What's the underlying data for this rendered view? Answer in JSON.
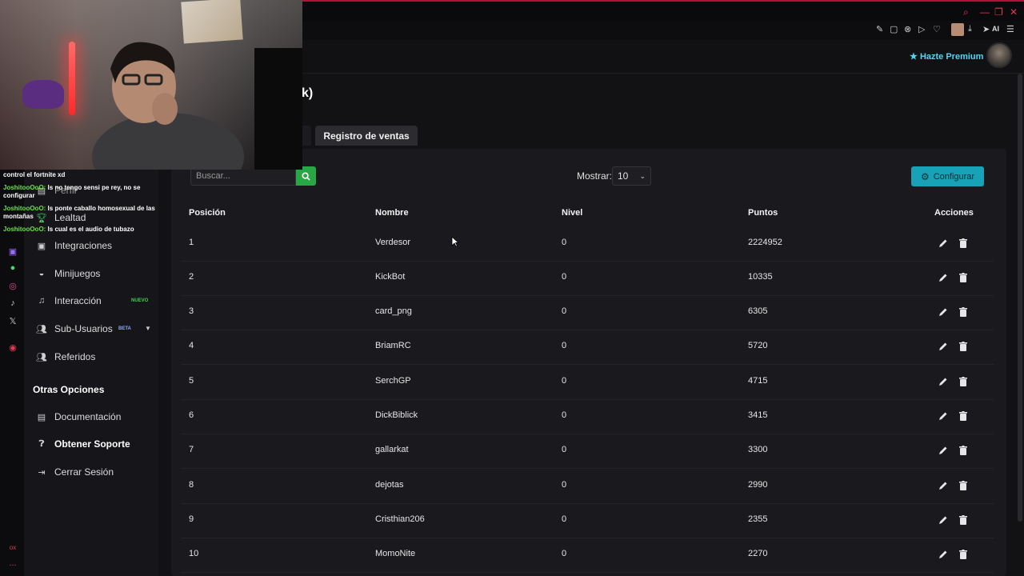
{
  "browser": {
    "ai_label": "AI",
    "accent": "#e03a55"
  },
  "header": {
    "premium_label": "Hazte Premium",
    "premium_color": "#55d4f0"
  },
  "page": {
    "title_fragment": "k)",
    "tab_active": "Registro de ventas"
  },
  "toolbar": {
    "search_placeholder": "Buscar...",
    "show_label": "Mostrar:",
    "show_value": "10",
    "config_label": "Configurar",
    "config_color": "#17a2b8",
    "search_btn_color": "#27a844"
  },
  "sidebar": {
    "partial_item": "Perfil",
    "items": [
      {
        "label": "Lealtad",
        "icon": "trophy-icon"
      },
      {
        "label": "Integraciones",
        "icon": "plug-icon"
      },
      {
        "label": "Minijuegos",
        "icon": "gamepad-icon"
      },
      {
        "label": "Interacción",
        "icon": "music-icon",
        "badge": "NUEVO"
      },
      {
        "label": "Sub-Usuarios",
        "icon": "users-icon",
        "badge": "BETA"
      },
      {
        "label": "Referidos",
        "icon": "user-group-icon"
      }
    ],
    "section_title": "Otras Opciones",
    "other": [
      {
        "label": "Documentación",
        "icon": "book-icon"
      },
      {
        "label": "Obtener Soporte",
        "icon": "question-icon"
      },
      {
        "label": "Cerrar Sesión",
        "icon": "logout-icon"
      }
    ]
  },
  "table": {
    "headers": [
      "Posición",
      "Nombre",
      "Nivel",
      "Puntos",
      "Acciones"
    ],
    "rows": [
      {
        "pos": "1",
        "name": "Verdesor",
        "level": "0",
        "points": "2224952"
      },
      {
        "pos": "2",
        "name": "KickBot",
        "level": "0",
        "points": "10335"
      },
      {
        "pos": "3",
        "name": "card_png",
        "level": "0",
        "points": "6305"
      },
      {
        "pos": "4",
        "name": "BriamRC",
        "level": "0",
        "points": "5720"
      },
      {
        "pos": "5",
        "name": "SerchGP",
        "level": "0",
        "points": "4715"
      },
      {
        "pos": "6",
        "name": "DickBiblick",
        "level": "0",
        "points": "3415"
      },
      {
        "pos": "7",
        "name": "gallarkat",
        "level": "0",
        "points": "3300"
      },
      {
        "pos": "8",
        "name": "dejotas",
        "level": "0",
        "points": "2990"
      },
      {
        "pos": "9",
        "name": "Cristhian206",
        "level": "0",
        "points": "2355"
      },
      {
        "pos": "10",
        "name": "MomoNite",
        "level": "0",
        "points": "2270"
      }
    ]
  },
  "chat": {
    "line0": "control el fortnite xd",
    "messages": [
      {
        "user": "JoshitooOoO:",
        "text": " ls no tengo sensi pe rey, no se configurar"
      },
      {
        "user": "JoshitooOoO:",
        "text": " ls ponte caballo homosexual de las montañas"
      },
      {
        "user": "JoshitooOoO:",
        "text": " ls cual es el audio de tubazo"
      }
    ]
  },
  "rail": {
    "bottom_label": "ox",
    "bottom_dots": "..."
  }
}
